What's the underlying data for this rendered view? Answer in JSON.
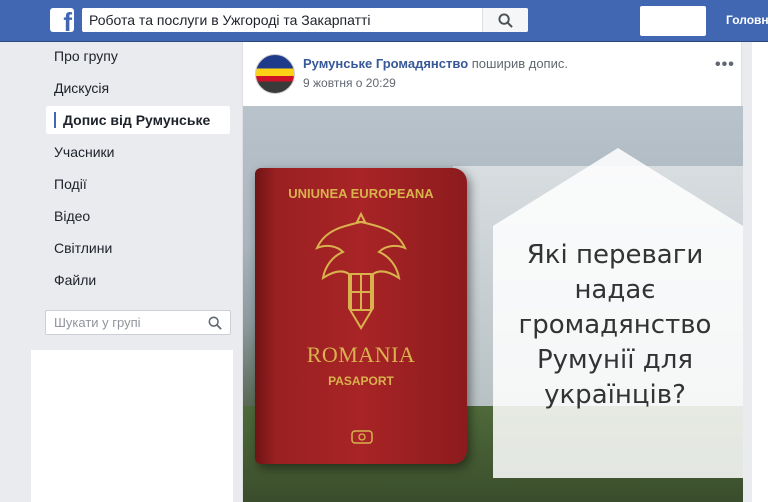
{
  "topbar": {
    "logo_icon": "facebook-logo-icon",
    "search_query": "Робота та послуги в Ужгороді та Закарпатті",
    "search_icon": "search-icon",
    "home_label": "Головн"
  },
  "sidebar": {
    "items": [
      {
        "label": "Про групу"
      },
      {
        "label": "Дискусія"
      },
      {
        "label": "Допис від Румунське",
        "active": true
      },
      {
        "label": "Учасники"
      },
      {
        "label": "Події"
      },
      {
        "label": "Відео"
      },
      {
        "label": "Світлини"
      },
      {
        "label": "Файли"
      }
    ],
    "search_placeholder": "Шукати у групі"
  },
  "post": {
    "author": "Румунське Громадянство",
    "action": "поширив допис.",
    "time": "9 жовтня о 20:29",
    "more_icon": "more-options-icon",
    "image": {
      "passport_top": "UNIUNEA EUROPEANA",
      "passport_country": "ROMANIA",
      "passport_type": "PASAPORT",
      "question_lines": [
        "Які переваги",
        "надає",
        "громадянство",
        "Румунії для",
        "українців?"
      ]
    }
  },
  "colors": {
    "brand": "#4267b2",
    "link": "#385898",
    "passport": "#a82426",
    "gold": "#d9b24e"
  }
}
